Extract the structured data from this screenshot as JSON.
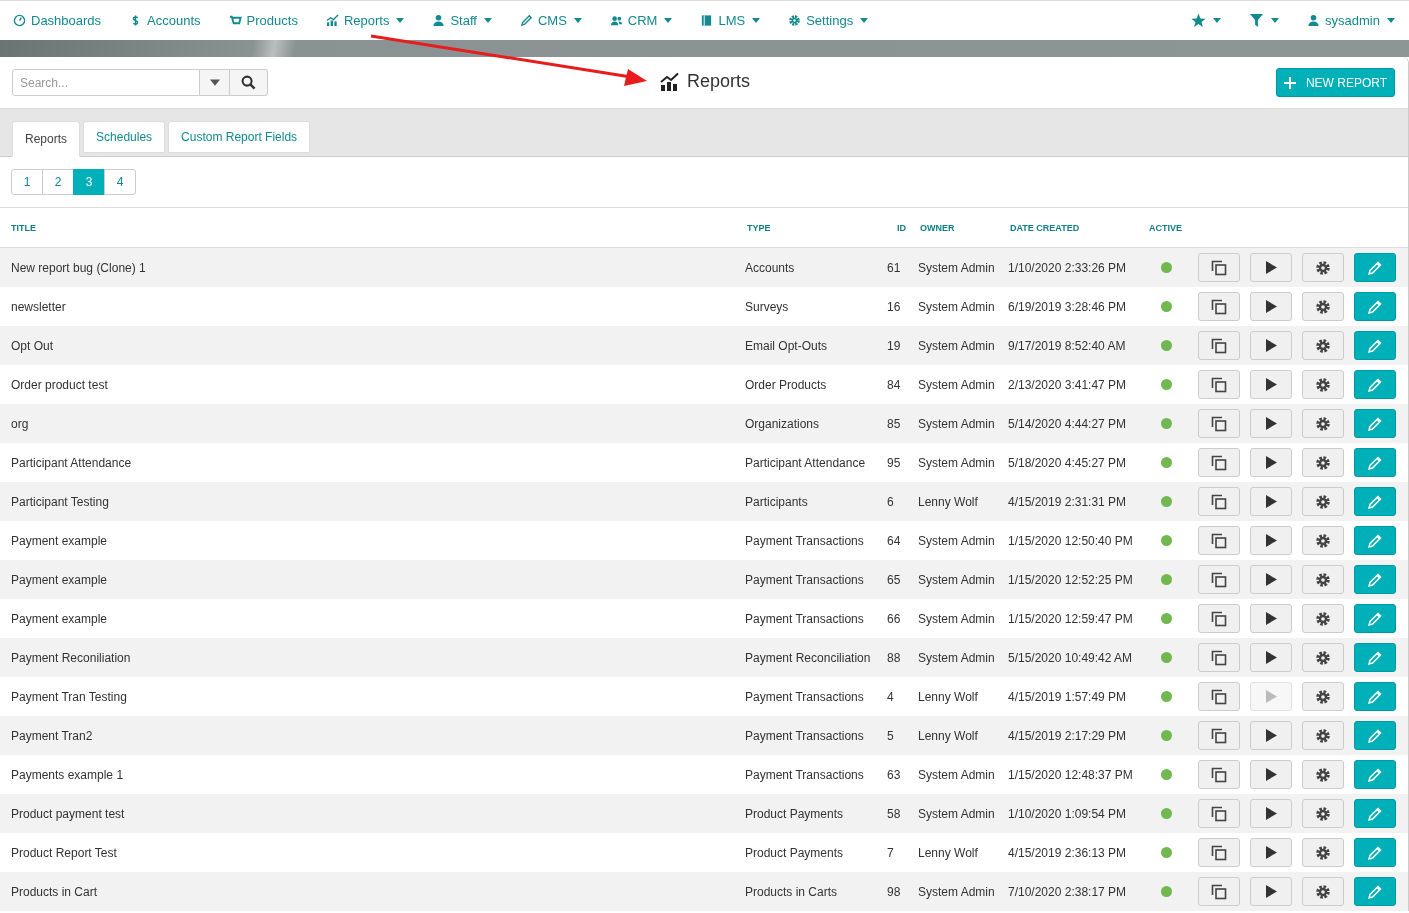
{
  "nav": {
    "items": [
      {
        "label": "Dashboards",
        "dropdown": false
      },
      {
        "label": "Accounts",
        "dropdown": false
      },
      {
        "label": "Products",
        "dropdown": false
      },
      {
        "label": "Reports",
        "dropdown": true
      },
      {
        "label": "Staff",
        "dropdown": true
      },
      {
        "label": "CMS",
        "dropdown": true
      },
      {
        "label": "CRM",
        "dropdown": true
      },
      {
        "label": "LMS",
        "dropdown": true
      },
      {
        "label": "Settings",
        "dropdown": true
      }
    ],
    "user": "sysadmin"
  },
  "search": {
    "placeholder": "Search..."
  },
  "page_title": "Reports",
  "new_button": "NEW REPORT",
  "tabs": [
    {
      "label": "Reports",
      "selected": true
    },
    {
      "label": "Schedules",
      "selected": false
    },
    {
      "label": "Custom Report Fields",
      "selected": false
    }
  ],
  "pages": [
    {
      "label": "1",
      "selected": false
    },
    {
      "label": "2",
      "selected": false
    },
    {
      "label": "3",
      "selected": true
    },
    {
      "label": "4",
      "selected": false
    }
  ],
  "table": {
    "columns": [
      "TITLE",
      "TYPE",
      "ID",
      "OWNER",
      "DATE CREATED",
      "ACTIVE"
    ],
    "rows": [
      {
        "title": "New report bug (Clone) 1",
        "type": "Accounts",
        "id": "61",
        "owner": "System Admin",
        "date": "1/10/2020 2:33:26 PM",
        "active": true,
        "run_disabled": false
      },
      {
        "title": "newsletter",
        "type": "Surveys",
        "id": "16",
        "owner": "System Admin",
        "date": "6/19/2019 3:28:46 PM",
        "active": true,
        "run_disabled": false
      },
      {
        "title": "Opt Out",
        "type": "Email Opt-Outs",
        "id": "19",
        "owner": "System Admin",
        "date": "9/17/2019 8:52:40 AM",
        "active": true,
        "run_disabled": false
      },
      {
        "title": "Order product test",
        "type": "Order Products",
        "id": "84",
        "owner": "System Admin",
        "date": "2/13/2020 3:41:47 PM",
        "active": true,
        "run_disabled": false
      },
      {
        "title": "org",
        "type": "Organizations",
        "id": "85",
        "owner": "System Admin",
        "date": "5/14/2020 4:44:27 PM",
        "active": true,
        "run_disabled": false
      },
      {
        "title": "Participant Attendance",
        "type": "Participant Attendance",
        "id": "95",
        "owner": "System Admin",
        "date": "5/18/2020 4:45:27 PM",
        "active": true,
        "run_disabled": false
      },
      {
        "title": "Participant Testing",
        "type": "Participants",
        "id": "6",
        "owner": "Lenny Wolf",
        "date": "4/15/2019 2:31:31 PM",
        "active": true,
        "run_disabled": false
      },
      {
        "title": "Payment example",
        "type": "Payment Transactions",
        "id": "64",
        "owner": "System Admin",
        "date": "1/15/2020 12:50:40 PM",
        "active": true,
        "run_disabled": false
      },
      {
        "title": "Payment example",
        "type": "Payment Transactions",
        "id": "65",
        "owner": "System Admin",
        "date": "1/15/2020 12:52:25 PM",
        "active": true,
        "run_disabled": false
      },
      {
        "title": "Payment example",
        "type": "Payment Transactions",
        "id": "66",
        "owner": "System Admin",
        "date": "1/15/2020 12:59:47 PM",
        "active": true,
        "run_disabled": false
      },
      {
        "title": "Payment Reconiliation",
        "type": "Payment Reconciliation",
        "id": "88",
        "owner": "System Admin",
        "date": "5/15/2020 10:49:42 AM",
        "active": true,
        "run_disabled": false
      },
      {
        "title": "Payment Tran Testing",
        "type": "Payment Transactions",
        "id": "4",
        "owner": "Lenny Wolf",
        "date": "4/15/2019 1:57:49 PM",
        "active": true,
        "run_disabled": true
      },
      {
        "title": "Payment Tran2",
        "type": "Payment Transactions",
        "id": "5",
        "owner": "Lenny Wolf",
        "date": "4/15/2019 2:17:29 PM",
        "active": true,
        "run_disabled": false
      },
      {
        "title": "Payments example 1",
        "type": "Payment Transactions",
        "id": "63",
        "owner": "System Admin",
        "date": "1/15/2020 12:48:37 PM",
        "active": true,
        "run_disabled": false
      },
      {
        "title": "Product payment test",
        "type": "Product Payments",
        "id": "58",
        "owner": "System Admin",
        "date": "1/10/2020 1:09:54 PM",
        "active": true,
        "run_disabled": false
      },
      {
        "title": "Product Report Test",
        "type": "Product Payments",
        "id": "7",
        "owner": "Lenny Wolf",
        "date": "4/15/2019 2:36:13 PM",
        "active": true,
        "run_disabled": false
      },
      {
        "title": "Products in Cart",
        "type": "Products in Carts",
        "id": "98",
        "owner": "System Admin",
        "date": "7/10/2020 2:38:17 PM",
        "active": true,
        "run_disabled": false
      }
    ]
  }
}
